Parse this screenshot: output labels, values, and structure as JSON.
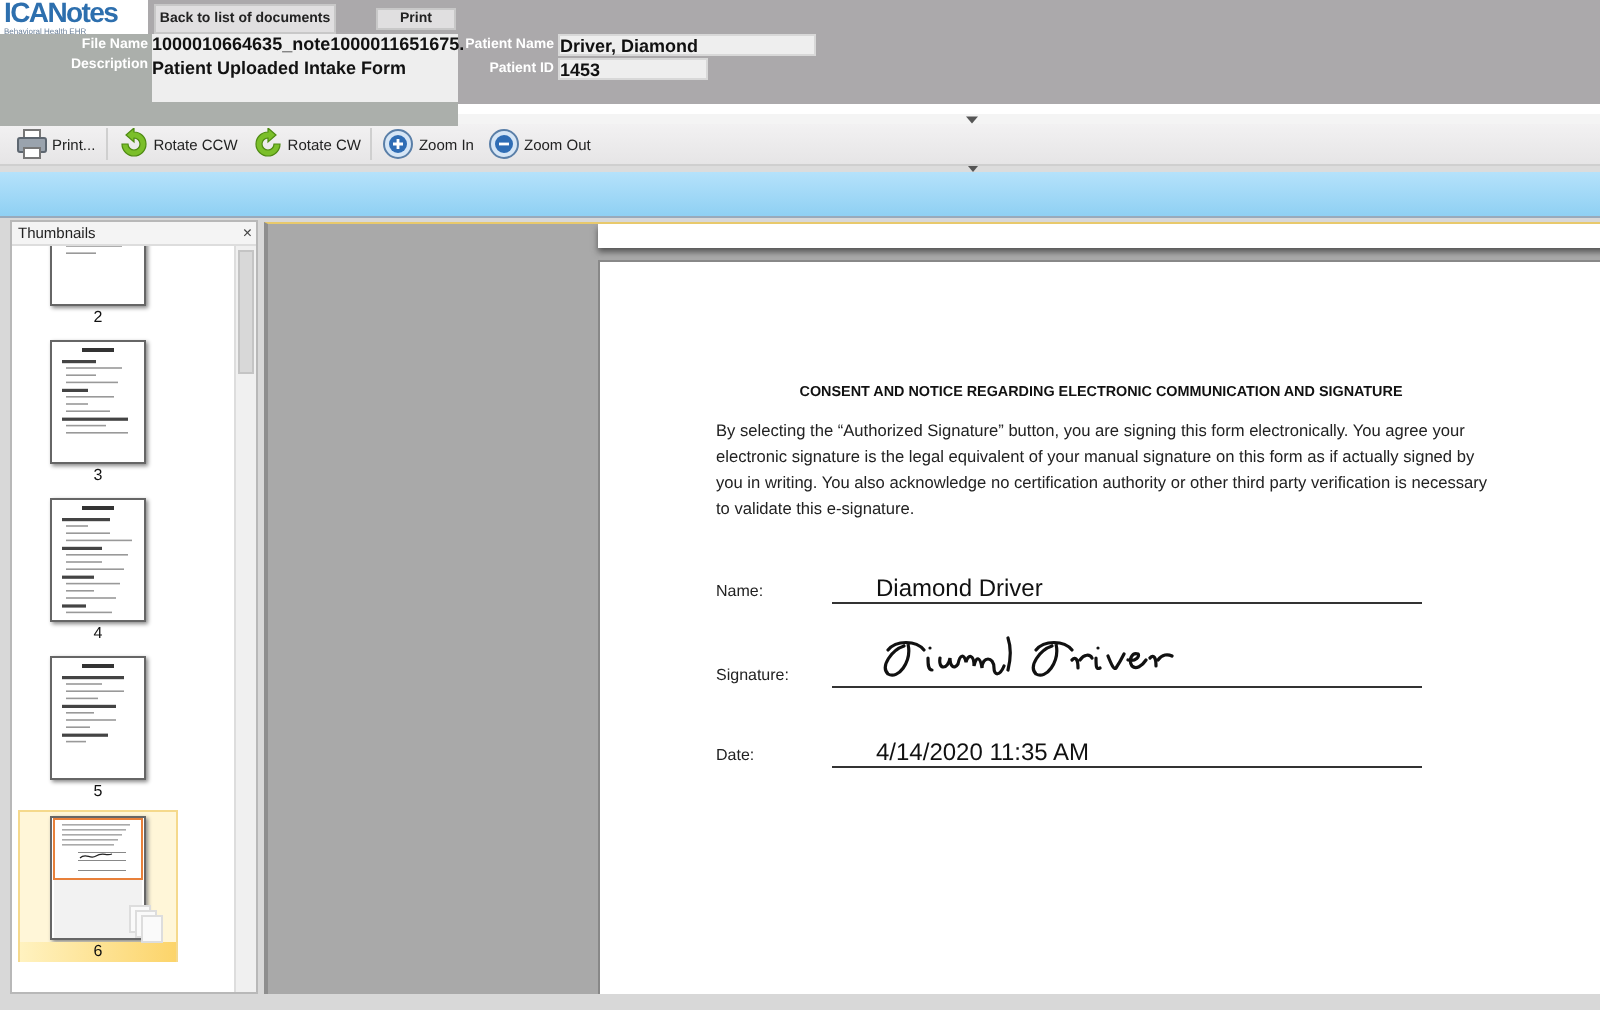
{
  "logo": {
    "name": "ICANotes",
    "tagline": "Behavioral Health EHR"
  },
  "header_buttons": [
    "Back to list of documents",
    "Print"
  ],
  "fields_left": [
    {
      "label": "File Name",
      "value": "1000010664635_note1000011651675."
    },
    {
      "label": "Description",
      "value": "Patient Uploaded Intake Form"
    }
  ],
  "fields_right": [
    {
      "label": "Patient Name",
      "value": "Driver, Diamond"
    },
    {
      "label": "Patient ID",
      "value": "1453"
    }
  ],
  "toolbar": [
    {
      "kind": "print",
      "label": "Print..."
    },
    {
      "kind": "rotate-ccw",
      "label": "Rotate CCW"
    },
    {
      "kind": "rotate-cw",
      "label": "Rotate CW"
    },
    {
      "kind": "zoom-in",
      "label": "Zoom In"
    },
    {
      "kind": "zoom-out",
      "label": "Zoom Out"
    }
  ],
  "thumbnails": {
    "title": "Thumbnails",
    "close": "×",
    "items": [
      {
        "label": "2",
        "selected": false
      },
      {
        "label": "3",
        "selected": false
      },
      {
        "label": "4",
        "selected": false
      },
      {
        "label": "5",
        "selected": false
      },
      {
        "label": "6",
        "selected": true
      }
    ]
  },
  "document": {
    "heading": "CONSENT AND NOTICE REGARDING ELECTRONIC COMMUNICATION AND SIGNATURE",
    "paragraph": "By selecting the “Authorized Signature” button, you are signing this form electronically. You agree your electronic signature is the legal equivalent of your manual signature on this form as if actually signed by you in writing. You also acknowledge no certification authority or other third party verification is necessary to validate this e-signature.",
    "fields": [
      {
        "kind": "text",
        "label": "Name:",
        "value": "Diamond Driver"
      },
      {
        "kind": "signature",
        "label": "Signature:"
      },
      {
        "kind": "text",
        "label": "Date:",
        "value": "4/14/2020 11:35 AM"
      }
    ]
  }
}
